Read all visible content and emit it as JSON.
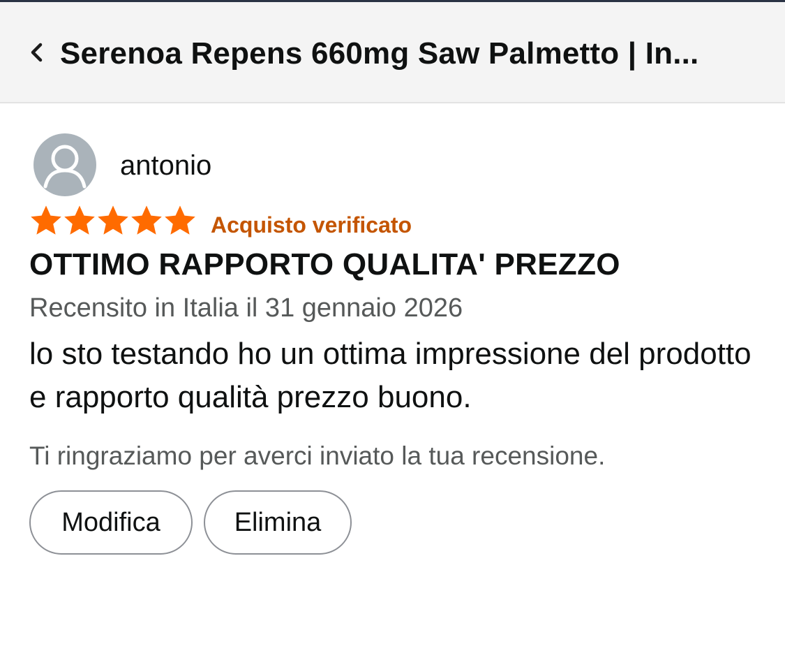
{
  "header": {
    "title": "Serenoa Repens 660mg Saw Palmetto | In..."
  },
  "review": {
    "author": "antonio",
    "rating": 5,
    "rating_max": 5,
    "verified_label": "Acquisto verificato",
    "title": "OTTIMO RAPPORTO QUALITA' PREZZO",
    "date_line": "Recensito in Italia il 31 gennaio 2026",
    "body": "lo sto testando ho un ottima impressione del prodotto e rapporto qualità prezzo buono.",
    "thanks_message": "Ti ringraziamo per averci inviato la tua recensione."
  },
  "actions": {
    "edit_label": "Modifica",
    "delete_label": "Elimina"
  },
  "colors": {
    "star": "#ff6b00",
    "verified": "#c45500",
    "avatar_bg": "#aab3ba"
  },
  "icons": {
    "back": "chevron-left-icon",
    "avatar": "user-silhouette-icon",
    "star": "star-icon"
  }
}
